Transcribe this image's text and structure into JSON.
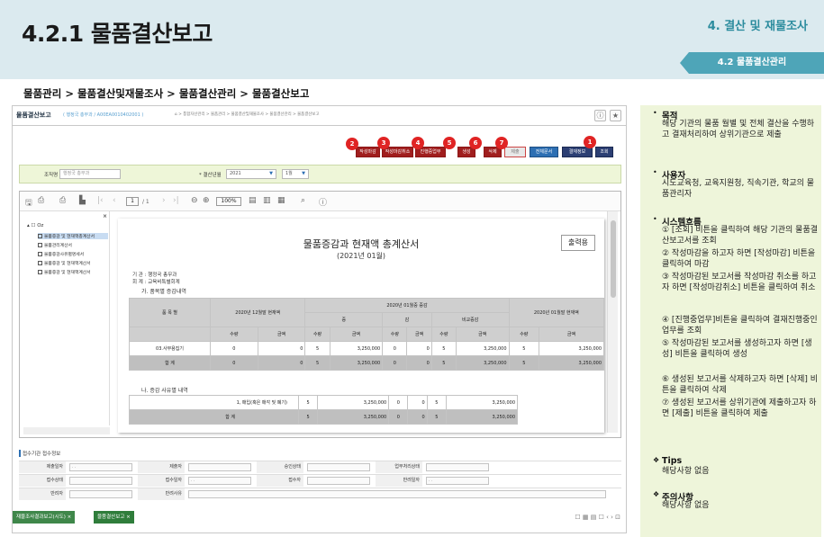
{
  "header": {
    "title": "4.2.1 물품결산보고",
    "section": "4. 결산 및 재물조사",
    "subsection": "4.2 물품결산관리"
  },
  "breadcrumb": "물품관리 > 물품결산및재물조사 > 물품결산관리 > 물품결산보고",
  "app": {
    "title": "물품결산보고",
    "meta": "( 행정국 총무과 / A00EA0010402001 )",
    "path": "⌂ > 통합자산관리 > 물품관리 > 물품결산및재물조사 > 물품결산관리 > 물품결산보고",
    "info_icon": "ⓘ",
    "star_icon": "★",
    "buttons": [
      {
        "key": "write_close",
        "label": "작성마감",
        "badge": "2"
      },
      {
        "key": "write_cancel",
        "label": "작성마감취소",
        "badge": "3"
      },
      {
        "key": "in_progress",
        "label": "진행중업무",
        "badge": "4"
      },
      {
        "key": "create",
        "label": "생성",
        "badge": "5"
      },
      {
        "key": "delete",
        "label": "삭제",
        "badge": "6"
      },
      {
        "key": "submit",
        "label": "제출",
        "badge": "7"
      },
      {
        "key": "print_all",
        "label": "전체문서",
        "badge": ""
      },
      {
        "key": "approval_info",
        "label": "결재정보",
        "badge": ""
      },
      {
        "key": "search",
        "label": "조회",
        "badge": "1"
      }
    ],
    "filter": {
      "org_label": "조직명",
      "org_value": "행정국 총무과",
      "period_label": "* 결산년월",
      "year": "2021",
      "month": "1월"
    },
    "viewer": {
      "page_current": "1",
      "page_total": "/ 1",
      "zoom": "100%"
    },
    "tree": {
      "close": "×",
      "root": "Oz",
      "items": [
        "물품증감 및 현재액총계산서",
        "물품관리계산서",
        "물품증감사유별명세서",
        "물품증감 및 현재액계산서",
        "물품증감 및 현재액계산서"
      ]
    },
    "report": {
      "title": "물품증감과 현재액 총계산서",
      "subtitle": "(2021년 01월)",
      "output_label": "출력용",
      "info1": "기     관 : 행정국 총무과",
      "info2": "회     계 : 교육비특별회계",
      "sec1": "가. 품목별 증감내역",
      "sec2": "나. 증감 사유별 내역",
      "cols": {
        "item": "품 목 별",
        "prev": "2020년 12월말 현재액",
        "change": "2020년 01월중 증감",
        "inc": "증",
        "dec": "감",
        "net": "비교증감",
        "cur": "2020년 01월말 현재액",
        "qty": "수량",
        "amt": "금액"
      },
      "rows": [
        {
          "name": "03.사무용집기",
          "v": [
            "0",
            "0",
            "5",
            "3,250,000",
            "0",
            "0",
            "5",
            "3,250,000",
            "5",
            "3,250,000"
          ]
        },
        {
          "name": "합  계",
          "v": [
            "0",
            "0",
            "5",
            "3,250,000",
            "0",
            "0",
            "5",
            "3,250,000",
            "5",
            "3,250,000"
          ]
        }
      ],
      "rows2": [
        {
          "name": "1, 매입(혹은 매각 및 폐기)",
          "v": [
            "5",
            "3,250,000",
            "0",
            "0",
            "5",
            "3,250,000"
          ]
        },
        {
          "name": "합 계",
          "v": [
            "5",
            "3,250,000",
            "0",
            "0",
            "5",
            "3,250,000"
          ]
        }
      ]
    },
    "bottom": {
      "title": "접수기관 접수정보",
      "r1": [
        "제출일자",
        "제출자",
        "승인상태",
        "업무처리상태"
      ],
      "r2": [
        "접수상태",
        "접수일자",
        "접수자",
        "반려일자"
      ],
      "r3": [
        "반려자",
        "반려사유"
      ],
      "date_placeholder": ". ."
    },
    "tabs": [
      {
        "label": "재물조사결과보고(시도)  ×"
      },
      {
        "label": "물품결산보고  ×"
      }
    ],
    "tab_icons": "☐ ▦ ▤ ☐ ‹ › ⊡"
  },
  "panel": {
    "purpose_title": "목적",
    "purpose_text": "해당 기관의 물품 월별 및 전체 결산을 수행하고 결재처리하여 상위기관으로 제출",
    "users_title": "사용자",
    "users_text": "시도교육청, 교육지원청, 직속기관, 학교의 물품관리자",
    "flow_title": "시스템흐름",
    "flow_steps": [
      "① [조회] 비튼을 클릭하여 해당 기관의 물품결산보고서를 조회",
      "② 작성마감을 하고자 하면 [작성마감] 비튼을 클릭하여 마감",
      "③ 작성마감된 보고서를 작성마감 취소를 하고자 하면 [작성마감취소] 비튼을 클릭하여 취소",
      "④ [진행중업무]비튼을 클릭하여 결재진행중인 업무를 조회",
      "⑤ 작성마감된 보고서를 생성하고자 하면 [생성] 비튼을 클릭하여 생성",
      "⑥ 생성된 보고서를 삭제하고자 하면 [삭제] 비튼을 클릭하여 삭제",
      "⑦ 생성된 보고서를 상위기관에 제출하고자 하면 [제출] 비튼을 클릭하여 제출"
    ],
    "tips_title": "Tips",
    "tips_text": "해당사항 없음",
    "caution_title": "주의사항",
    "caution_text": "해당사항 없음",
    "bullet": "•",
    "diamond": "❖"
  }
}
